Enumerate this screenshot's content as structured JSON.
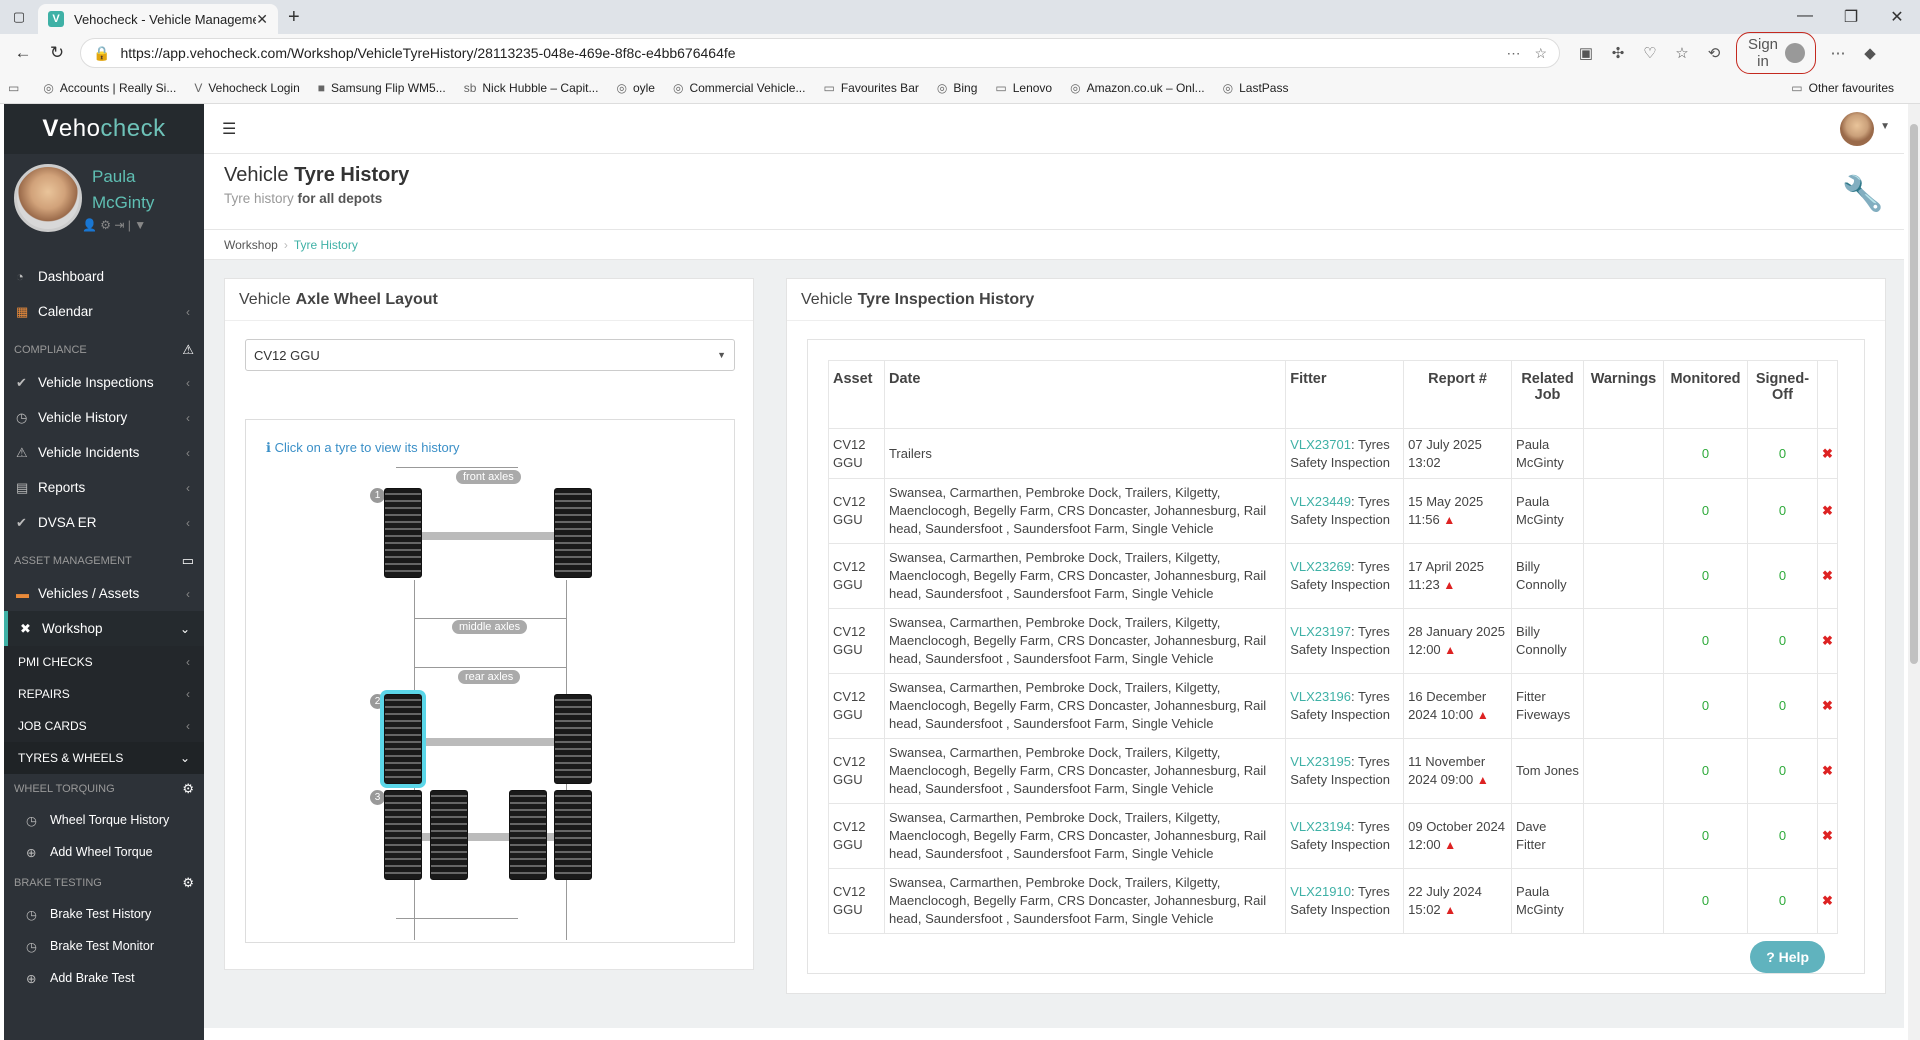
{
  "browser": {
    "tab_title": "Vehocheck - Vehicle Managemen",
    "url": "https://app.vehocheck.com/Workshop/VehicleTyreHistory/28113235-048e-469e-8f8c-e4bb676464fe",
    "sign_in": "Sign in",
    "bookmarks": [
      "Accounts | Really Si...",
      "Vehocheck Login",
      "Samsung Flip WM5...",
      "Nick Hubble – Capit...",
      "oyle",
      "Commercial Vehicle...",
      "Favourites Bar",
      "Bing",
      "Lenovo",
      "Amazon.co.uk – Onl...",
      "LastPass"
    ],
    "other_favourites": "Other favourites"
  },
  "sidebar": {
    "logo_v": "V",
    "logo_a": "eho",
    "logo_b": "check",
    "user_first": "Paula",
    "user_last": "McGinty",
    "items": {
      "dashboard": "Dashboard",
      "calendar": "Calendar",
      "compliance": "COMPLIANCE",
      "vehicle_inspections": "Vehicle Inspections",
      "vehicle_history": "Vehicle History",
      "vehicle_incidents": "Vehicle Incidents",
      "reports": "Reports",
      "dvsa_er": "DVSA ER",
      "asset_management": "ASSET MANAGEMENT",
      "vehicles_assets": "Vehicles / Assets",
      "workshop": "Workshop",
      "pmi_checks": "PMI CHECKS",
      "repairs": "REPAIRS",
      "job_cards": "JOB CARDS",
      "tyres_wheels": "TYRES & WHEELS",
      "wheel_torquing": "WHEEL TORQUING",
      "wheel_torque_history": "Wheel Torque History",
      "add_wheel_torque": "Add Wheel Torque",
      "brake_testing": "BRAKE TESTING",
      "brake_test_history": "Brake Test History",
      "brake_test_monitor": "Brake Test Monitor",
      "add_brake_test": "Add Brake Test"
    }
  },
  "page": {
    "title_a": "Vehicle",
    "title_b": "Tyre History",
    "subtitle_a": "Tyre history",
    "subtitle_b": "for all depots",
    "crumb_1": "Workshop",
    "crumb_2": "Tyre History"
  },
  "layout_panel": {
    "title_a": "Vehicle",
    "title_b": "Axle Wheel Layout",
    "selected_vehicle": "CV12 GGU",
    "hint": "Click on a tyre to view its history",
    "front": "front axles",
    "middle": "middle axles",
    "rear": "rear axles",
    "axle_numbers": [
      "1",
      "2",
      "3"
    ]
  },
  "history_panel": {
    "title_a": "Vehicle",
    "title_b": "Tyre Inspection History",
    "columns": [
      "Asset",
      "Date",
      "Fitter",
      "Report #",
      "Related Job",
      "Warnings",
      "Monitored",
      "Signed-Off"
    ],
    "rows": [
      {
        "asset": "CV12 GGU",
        "depots": "Trailers",
        "ref": "VLX23701",
        "type": ": Tyres Safety Inspection",
        "date": "07 July 2025 13:02",
        "warn": "",
        "fitter": "Paula McGinty",
        "monitored": "0",
        "signed": "0"
      },
      {
        "asset": "CV12 GGU",
        "depots": "Swansea, Carmarthen, Pembroke Dock, Trailers, Kilgetty, Maenclocogh, Begelly Farm, CRS Doncaster, Johannesburg, Rail head, Saundersfoot , Saundersfoot Farm, Single Vehicle",
        "ref": "VLX23449",
        "type": ": Tyres Safety Inspection",
        "date": "15 May 2025 11:56",
        "warn": "▲",
        "fitter": "Paula McGinty",
        "monitored": "0",
        "signed": "0"
      },
      {
        "asset": "CV12 GGU",
        "depots": "Swansea, Carmarthen, Pembroke Dock, Trailers, Kilgetty, Maenclocogh, Begelly Farm, CRS Doncaster, Johannesburg, Rail head, Saundersfoot , Saundersfoot Farm, Single Vehicle",
        "ref": "VLX23269",
        "type": ": Tyres Safety Inspection",
        "date": "17 April 2025 11:23",
        "warn": "▲",
        "fitter": "Billy Connolly",
        "monitored": "0",
        "signed": "0"
      },
      {
        "asset": "CV12 GGU",
        "depots": "Swansea, Carmarthen, Pembroke Dock, Trailers, Kilgetty, Maenclocogh, Begelly Farm, CRS Doncaster, Johannesburg, Rail head, Saundersfoot , Saundersfoot Farm, Single Vehicle",
        "ref": "VLX23197",
        "type": ": Tyres Safety Inspection",
        "date": "28 January 2025 12:00",
        "warn": "▲",
        "fitter": "Billy Connolly",
        "monitored": "0",
        "signed": "0"
      },
      {
        "asset": "CV12 GGU",
        "depots": "Swansea, Carmarthen, Pembroke Dock, Trailers, Kilgetty, Maenclocogh, Begelly Farm, CRS Doncaster, Johannesburg, Rail head, Saundersfoot , Saundersfoot Farm, Single Vehicle",
        "ref": "VLX23196",
        "type": ": Tyres Safety Inspection",
        "date": "16 December 2024 10:00",
        "warn": "▲",
        "fitter": "Fitter Fiveways",
        "monitored": "0",
        "signed": "0"
      },
      {
        "asset": "CV12 GGU",
        "depots": "Swansea, Carmarthen, Pembroke Dock, Trailers, Kilgetty, Maenclocogh, Begelly Farm, CRS Doncaster, Johannesburg, Rail head, Saundersfoot , Saundersfoot Farm, Single Vehicle",
        "ref": "VLX23195",
        "type": ": Tyres Safety Inspection",
        "date": "11 November 2024 09:00",
        "warn": "▲",
        "fitter": "Tom Jones",
        "monitored": "0",
        "signed": "0"
      },
      {
        "asset": "CV12 GGU",
        "depots": "Swansea, Carmarthen, Pembroke Dock, Trailers, Kilgetty, Maenclocogh, Begelly Farm, CRS Doncaster, Johannesburg, Rail head, Saundersfoot , Saundersfoot Farm, Single Vehicle",
        "ref": "VLX23194",
        "type": ": Tyres Safety Inspection",
        "date": "09 October 2024 12:00",
        "warn": "▲",
        "fitter": "Dave Fitter",
        "monitored": "0",
        "signed": "0"
      },
      {
        "asset": "CV12 GGU",
        "depots": "Swansea, Carmarthen, Pembroke Dock, Trailers, Kilgetty, Maenclocogh, Begelly Farm, CRS Doncaster, Johannesburg, Rail head, Saundersfoot , Saundersfoot Farm, Single Vehicle",
        "ref": "VLX21910",
        "type": ": Tyres Safety Inspection",
        "date": "22 July 2024 15:02",
        "warn": "▲",
        "fitter": "Paula McGinty",
        "monitored": "0",
        "signed": "0"
      }
    ],
    "delete_glyph": "✖"
  },
  "help": "Help",
  "colors": {
    "accent": "#3fb1a6",
    "sidebar": "#2d3238",
    "danger": "#dd2222",
    "success": "#2eaa3a"
  }
}
